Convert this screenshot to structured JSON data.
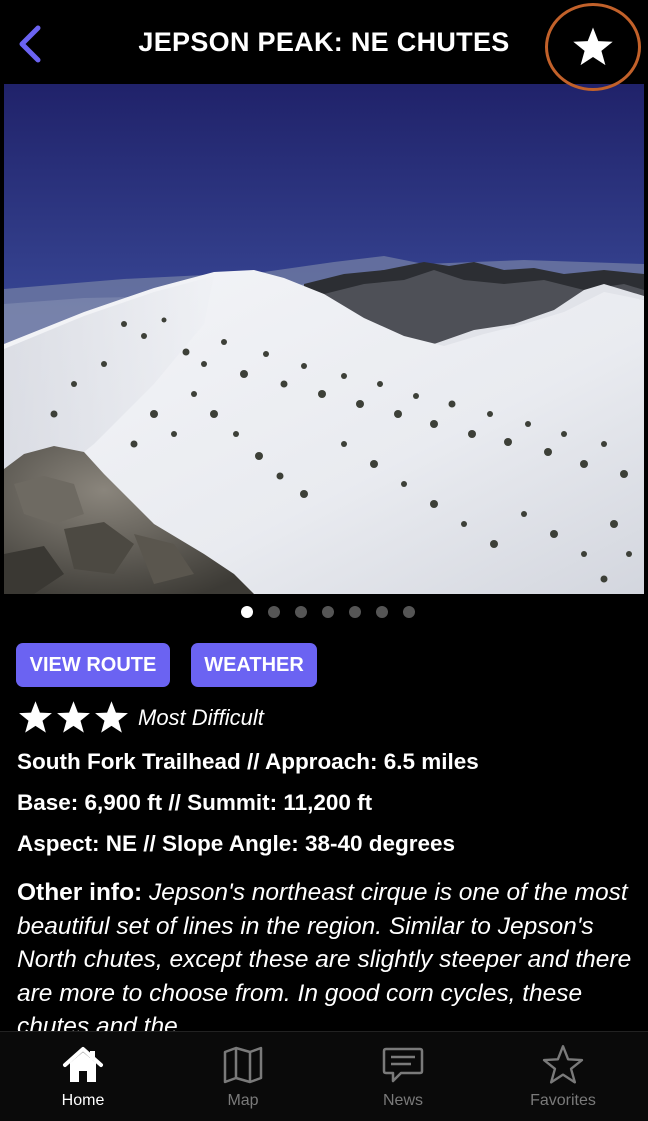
{
  "header": {
    "title": "JEPSON PEAK: NE CHUTES",
    "back_icon": "chevron-left-icon",
    "favorite_icon": "star-icon",
    "accent_color": "#6b63f2",
    "highlight_ring_color": "#c2612a"
  },
  "gallery": {
    "image_description_icon": "mountain-photo",
    "page_count": 7,
    "active_page": 1
  },
  "actions": {
    "view_route_label": "VIEW ROUTE",
    "weather_label": "WEATHER",
    "button_color": "#6b63f2"
  },
  "difficulty": {
    "stars": 3,
    "label": "Most Difficult"
  },
  "details": {
    "approach": "South Fork Trailhead // Approach: 6.5 miles",
    "elevation": "Base: 6,900 ft // Summit: 11,200 ft",
    "aspect": "Aspect: NE // Slope Angle: 38-40 degrees",
    "other_label": "Other info:",
    "other_text": "Jepson's northeast cirque is one of the most beautiful set of lines in the region. Similar to Jepson's North chutes, except these are slightly steeper and there are more to choose from. In good corn cycles, these chutes and the"
  },
  "tabs": [
    {
      "label": "Home",
      "icon": "home-icon",
      "active": true
    },
    {
      "label": "Map",
      "icon": "map-icon",
      "active": false
    },
    {
      "label": "News",
      "icon": "chat-icon",
      "active": false
    },
    {
      "label": "Favorites",
      "icon": "star-outline-icon",
      "active": false
    }
  ]
}
